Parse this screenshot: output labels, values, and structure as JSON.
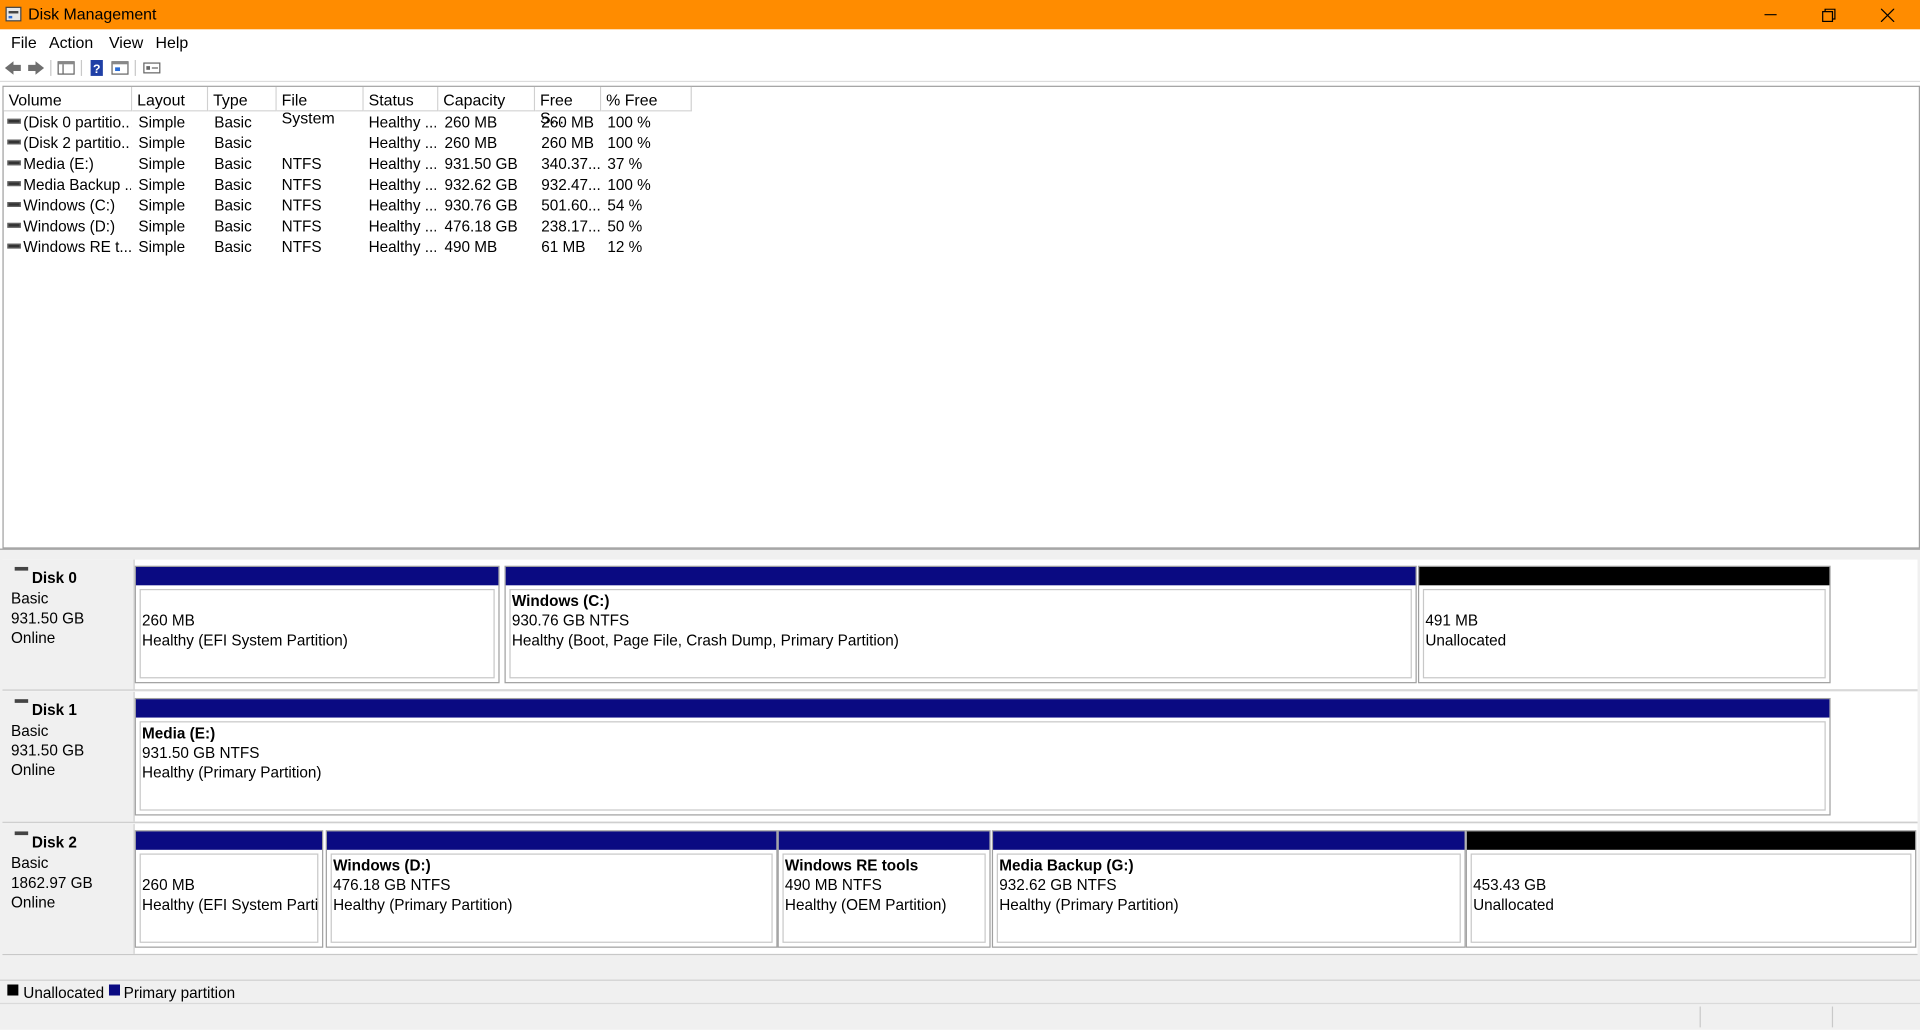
{
  "window": {
    "title": "Disk Management",
    "accent_color": "#ff8c00"
  },
  "menu": [
    "File",
    "Action",
    "View",
    "Help"
  ],
  "toolbar": {
    "icons": [
      "back-icon",
      "forward-icon",
      "console-tree-icon",
      "help-icon",
      "properties-icon",
      "legend-icon"
    ]
  },
  "volume_list": {
    "columns": [
      "Volume",
      "Layout",
      "Type",
      "File System",
      "Status",
      "Capacity",
      "Free S...",
      "% Free"
    ],
    "rows": [
      [
        "(Disk 0 partitio...",
        "Simple",
        "Basic",
        "",
        "Healthy ...",
        "260 MB",
        "260 MB",
        "100 %"
      ],
      [
        "(Disk 2 partitio...",
        "Simple",
        "Basic",
        "",
        "Healthy ...",
        "260 MB",
        "260 MB",
        "100 %"
      ],
      [
        "Media (E:)",
        "Simple",
        "Basic",
        "NTFS",
        "Healthy ...",
        "931.50 GB",
        "340.37...",
        "37 %"
      ],
      [
        "Media Backup ...",
        "Simple",
        "Basic",
        "NTFS",
        "Healthy ...",
        "932.62 GB",
        "932.47...",
        "100 %"
      ],
      [
        "Windows (C:)",
        "Simple",
        "Basic",
        "NTFS",
        "Healthy ...",
        "930.76 GB",
        "501.60...",
        "54 %"
      ],
      [
        "Windows (D:)",
        "Simple",
        "Basic",
        "NTFS",
        "Healthy ...",
        "476.18 GB",
        "238.17...",
        "50 %"
      ],
      [
        "Windows RE t...",
        "Simple",
        "Basic",
        "NTFS",
        "Healthy ...",
        "490 MB",
        "61 MB",
        "12 %"
      ]
    ]
  },
  "disks": [
    {
      "name": "Disk 0",
      "type": "Basic",
      "size": "931.50 GB",
      "state": "Online",
      "partitions": [
        {
          "title": "",
          "size": "260 MB",
          "status": "Healthy (EFI System Partition)"
        },
        {
          "title": "Windows  (C:)",
          "size": "930.76 GB NTFS",
          "status": "Healthy (Boot, Page File, Crash Dump, Primary Partition)"
        },
        {
          "title": "",
          "size": "491 MB",
          "status": "Unallocated"
        }
      ]
    },
    {
      "name": "Disk 1",
      "type": "Basic",
      "size": "931.50 GB",
      "state": "Online",
      "partitions": [
        {
          "title": "Media  (E:)",
          "size": "931.50 GB NTFS",
          "status": "Healthy (Primary Partition)"
        }
      ]
    },
    {
      "name": "Disk 2",
      "type": "Basic",
      "size": "1862.97 GB",
      "state": "Online",
      "partitions": [
        {
          "title": "",
          "size": "260 MB",
          "status": "Healthy (EFI System Partiti"
        },
        {
          "title": "Windows  (D:)",
          "size": "476.18 GB NTFS",
          "status": "Healthy (Primary Partition)"
        },
        {
          "title": "Windows RE tools",
          "size": "490 MB NTFS",
          "status": "Healthy (OEM Partition)"
        },
        {
          "title": "Media Backup  (G:)",
          "size": "932.62 GB NTFS",
          "status": "Healthy (Primary Partition)"
        },
        {
          "title": "",
          "size": "453.43 GB",
          "status": "Unallocated"
        }
      ]
    }
  ],
  "legend": {
    "unallocated": "Unallocated",
    "primary": "Primary partition",
    "unallocated_color": "#000000",
    "primary_color": "#0a0a82"
  }
}
